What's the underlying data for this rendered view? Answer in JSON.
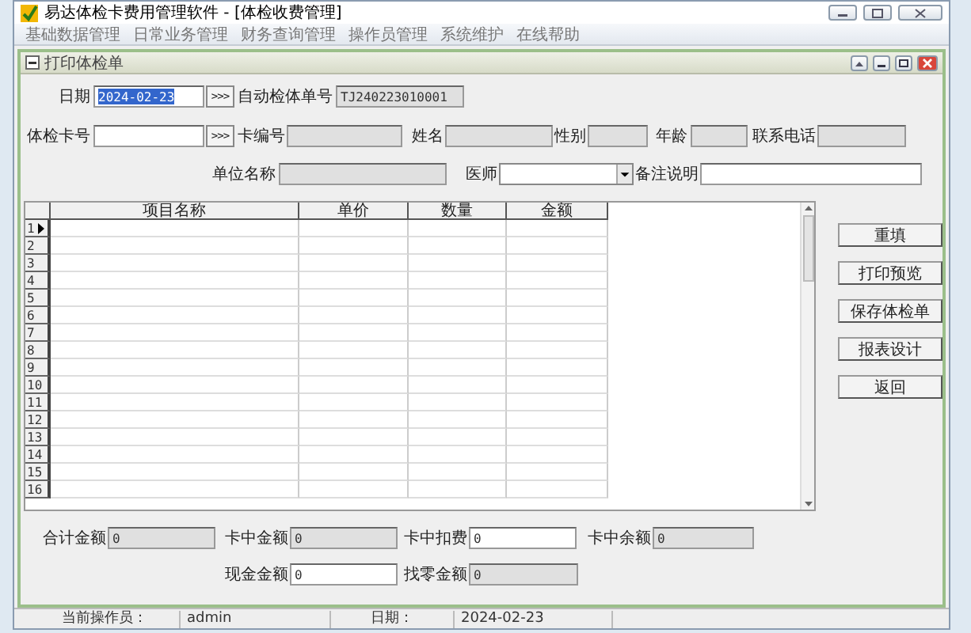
{
  "app": {
    "title": "易达体检卡费用管理软件  - [体检收费管理]"
  },
  "menu": [
    "基础数据管理",
    "日常业务管理",
    "财务查询管理",
    "操作员管理",
    "系统维护",
    "在线帮助"
  ],
  "form": {
    "title": "打印体检单",
    "lines": [
      {
        "fields": [
          {
            "kind": "label",
            "text": "日期"
          },
          {
            "kind": "input",
            "value": "2024-02-23",
            "highlighted": true
          },
          {
            "kind": "button",
            "text": ">>>"
          },
          {
            "kind": "label",
            "text": "自动检体单号"
          },
          {
            "kind": "readonly",
            "value": "TJ240223010001"
          }
        ]
      },
      {
        "fields": [
          {
            "kind": "label",
            "text": "体检卡号"
          },
          {
            "kind": "input"
          },
          {
            "kind": "button",
            "text": ">>>"
          },
          {
            "kind": "label",
            "text": "卡编号"
          },
          {
            "kind": "readonly"
          },
          {
            "kind": "label",
            "text": "姓名"
          },
          {
            "kind": "readonly"
          },
          {
            "kind": "label",
            "text": "性别"
          },
          {
            "kind": "readonly"
          },
          {
            "kind": "label",
            "text": "年龄"
          },
          {
            "kind": "readonly"
          },
          {
            "kind": "label",
            "text": "联系电话"
          },
          {
            "kind": "readonly"
          }
        ]
      },
      {
        "fields": [
          {
            "kind": "label",
            "text": "单位名称"
          },
          {
            "kind": "readonly"
          },
          {
            "kind": "label",
            "text": "医师"
          },
          {
            "kind": "select"
          },
          {
            "kind": "label",
            "text": "备注说明"
          },
          {
            "kind": "input"
          }
        ]
      }
    ]
  },
  "table": {
    "columns": [
      "项目名称",
      "单价",
      "数量",
      "金额"
    ],
    "rows": [
      {
        "number": "1",
        "current": true
      },
      {
        "number": "2",
        "current": false
      },
      {
        "number": "3",
        "current": false
      },
      {
        "number": "4",
        "current": false
      },
      {
        "number": "5",
        "current": false
      },
      {
        "number": "6",
        "current": false
      },
      {
        "number": "7",
        "current": false
      },
      {
        "number": "8",
        "current": false
      },
      {
        "number": "9",
        "current": false
      },
      {
        "number": "10",
        "current": false
      },
      {
        "number": "11",
        "current": false
      },
      {
        "number": "12",
        "current": false
      },
      {
        "number": "13",
        "current": false
      },
      {
        "number": "14",
        "current": false
      },
      {
        "number": "15",
        "current": false
      },
      {
        "number": "16",
        "current": false
      }
    ]
  },
  "actions": [
    "重填",
    "打印预览",
    "保存体检单",
    "报表设计",
    "返回"
  ],
  "totals": [
    {
      "fields": [
        {
          "kind": "label",
          "text": "合计金额"
        },
        {
          "kind": "readonly",
          "value": "0"
        },
        {
          "kind": "label",
          "text": "卡中金额"
        },
        {
          "kind": "readonly",
          "value": "0"
        },
        {
          "kind": "label",
          "text": "卡中扣费"
        },
        {
          "kind": "input",
          "value": "0"
        },
        {
          "kind": "label",
          "text": "卡中余额"
        },
        {
          "kind": "readonly",
          "value": "0"
        }
      ]
    },
    {
      "fields": [
        {
          "kind": "label",
          "text": "现金金额"
        },
        {
          "kind": "input",
          "value": "0"
        },
        {
          "kind": "label",
          "text": "找零金额"
        },
        {
          "kind": "readonly",
          "value": "0"
        }
      ]
    }
  ],
  "status_bar": [
    {
      "label": "当前操作员：",
      "value": "admin"
    },
    {
      "label": "日期：",
      "value": "2024-02-23"
    }
  ]
}
